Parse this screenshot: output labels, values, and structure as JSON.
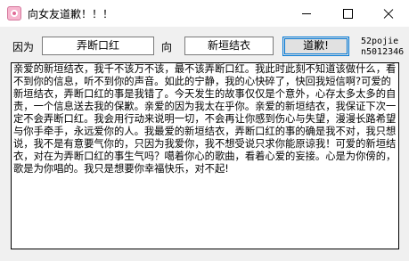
{
  "window": {
    "title": "向女友道歉！！！",
    "controls": {
      "minimize_icon": "minimize-icon",
      "maximize_icon": "maximize-icon",
      "close_icon": "close-icon"
    }
  },
  "form": {
    "because_label": "因为",
    "thing_value": "弄断口红",
    "to_label": "向",
    "person_value": "新垣结衣",
    "apology_button_label": "道歉!",
    "author_line1": "52pojie",
    "author_line2": "n5012346"
  },
  "message": {
    "text": "亲爱的新垣结衣，我千不该万不该，最不该弄断口红。我此时此刻不知道该做什么，看不到你的信息，听不到你的声音。如此的宁静，我的心快碎了，快回我短信啊?可爱的新垣结衣，弄断口红的事是我错了。今天发生的故事仅仅是个意外，心存太多太多的自责，一个信息送去我的保歉。亲爱的因为我太在乎你。亲爱的新垣结衣，我保证下次一定不会弄断口红。我会用行动来说明一切，不会再让你感到伤心与失望，漫漫长路希望与你手牵手，永远爱你的人。我最爱的新垣结衣，弄断口红的事的确是我不对，我只想说，我不是有意要气你的，只因为我爱你，我不想受说只求你能原谅我！可爱的新垣结衣，对在为弄断口红的事生气吗？噶着你心的歌曲，看着心爱的妄接。心是为你傍的，歌是为你唱的。我只是想要你幸福快乐，对不起!"
  }
}
